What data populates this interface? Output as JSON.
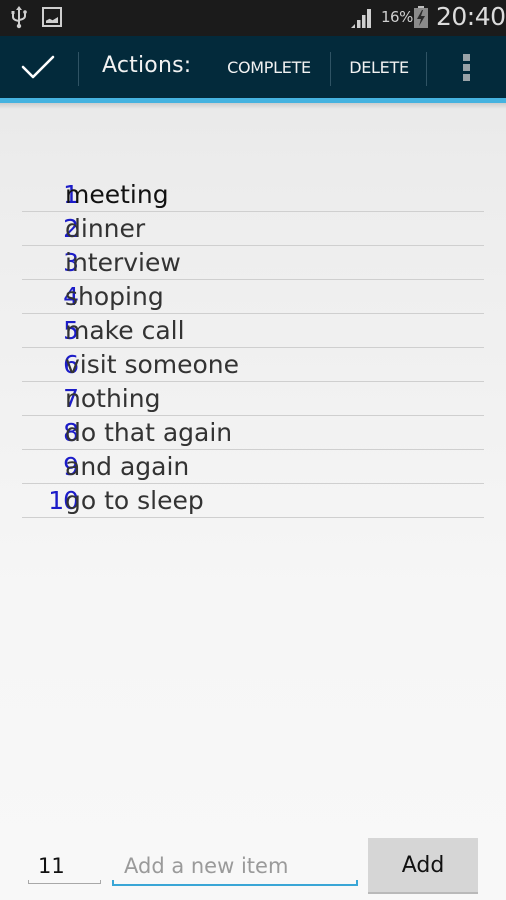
{
  "status_bar": {
    "icons_left": [
      "usb-icon",
      "gallery-icon"
    ],
    "signal_icon": "signal-bars-icon",
    "battery_percent": "16%",
    "battery_icon": "battery-charging-icon",
    "time": "20:40"
  },
  "action_bar": {
    "done_icon": "checkmark-icon",
    "title": "Actions:",
    "buttons": [
      {
        "label": "COMPLETE"
      },
      {
        "label": "DELETE"
      }
    ],
    "overflow_icon": "overflow-menu-icon",
    "colors": {
      "background": "#032a3b",
      "accent": "#46b3e0"
    }
  },
  "todo": {
    "number_color": "#1c1cc8",
    "items": [
      {
        "num": "1",
        "text": "meeting"
      },
      {
        "num": "2",
        "text": "dinner"
      },
      {
        "num": "3",
        "text": "interview"
      },
      {
        "num": "4",
        "text": "shoping"
      },
      {
        "num": "5",
        "text": "make call"
      },
      {
        "num": "6",
        "text": "visit someone"
      },
      {
        "num": "7",
        "text": "nothing"
      },
      {
        "num": "8",
        "text": "do that again"
      },
      {
        "num": "9",
        "text": "and again"
      },
      {
        "num": "10",
        "text": "go to sleep"
      }
    ]
  },
  "add_form": {
    "number_value": "11",
    "new_item_value": "",
    "new_item_placeholder": "Add a new item",
    "add_label": "Add"
  }
}
